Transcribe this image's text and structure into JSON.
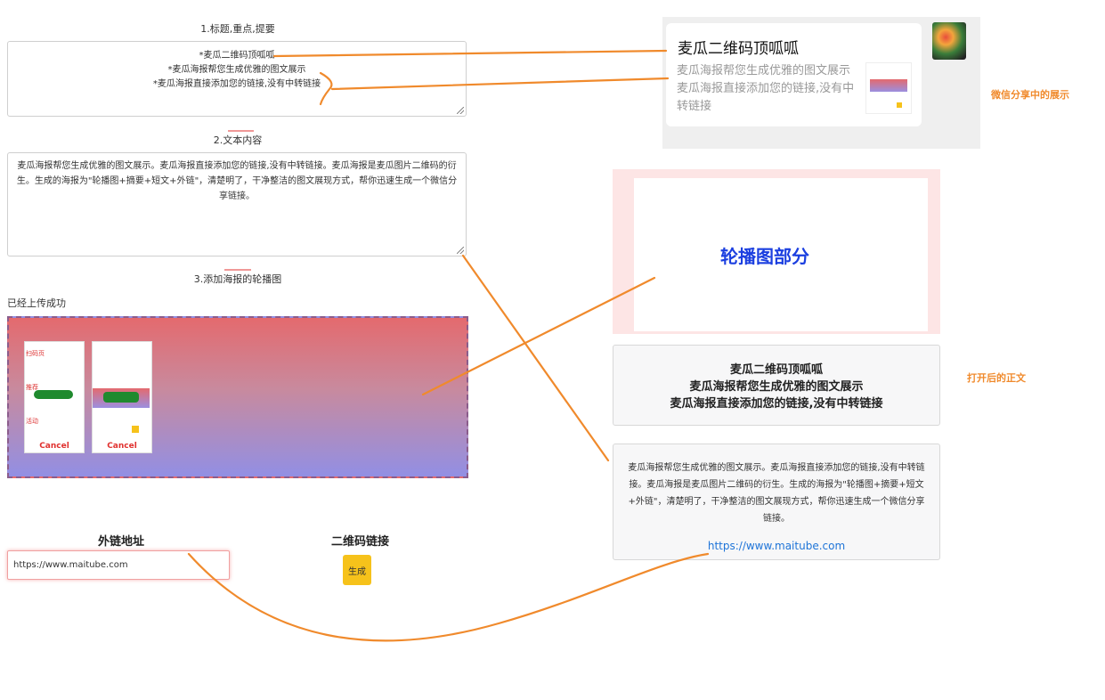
{
  "editor": {
    "section1_title": "1.标题,重点,提要",
    "title_lines": [
      "*麦瓜二维码顶呱呱",
      "*麦瓜海报帮您生成优雅的图文展示",
      "*麦瓜海报直接添加您的链接,没有中转链接"
    ],
    "section2_title": "2.文本内容",
    "content_text": "麦瓜海报帮您生成优雅的图文展示。麦瓜海报直接添加您的链接,没有中转链接。麦瓜海报是麦瓜图片二维码的衍生。生成的海报为\"轮播图+摘要+短文+外链\"，清楚明了，干净整洁的图文展现方式，帮你迅速生成一个微信分享链接。",
    "section3_title": "3.添加海报的轮播图",
    "upload_status": "已经上传成功",
    "thumb_cancel": "Cancel",
    "thumb1_labels": [
      "扫码页",
      "推荐",
      "活动"
    ],
    "external_label": "外链地址",
    "external_value": "https://www.maitube.com",
    "qr_label": "二维码链接",
    "generate_label": "生成"
  },
  "share_preview": {
    "title": "麦瓜二维码顶呱呱",
    "description": "麦瓜海报帮您生成优雅的图文展示麦瓜海报直接添加您的链接,没有中转链接",
    "annotation": "微信分享中的展示"
  },
  "opened_page": {
    "carousel_text": "轮播图部分",
    "title_lines": [
      "麦瓜二维码顶呱呱",
      "麦瓜海报帮您生成优雅的图文展示",
      "麦瓜海报直接添加您的链接,没有中转链接"
    ],
    "body_text": "麦瓜海报帮您生成优雅的图文展示。麦瓜海报直接添加您的链接,没有中转链接。麦瓜海报是麦瓜图片二维码的衍生。生成的海报为\"轮播图+摘要+短文+外链\"，清楚明了，干净整洁的图文展现方式，帮你迅速生成一个微信分享链接。",
    "link": "https://www.maitube.com",
    "annotation": "打开后的正文"
  },
  "colors": {
    "annotation_orange": "#f08a2c",
    "link_blue": "#1e74d8",
    "carousel_text": "#1b3fe0",
    "generate_button": "#f6c21b"
  }
}
